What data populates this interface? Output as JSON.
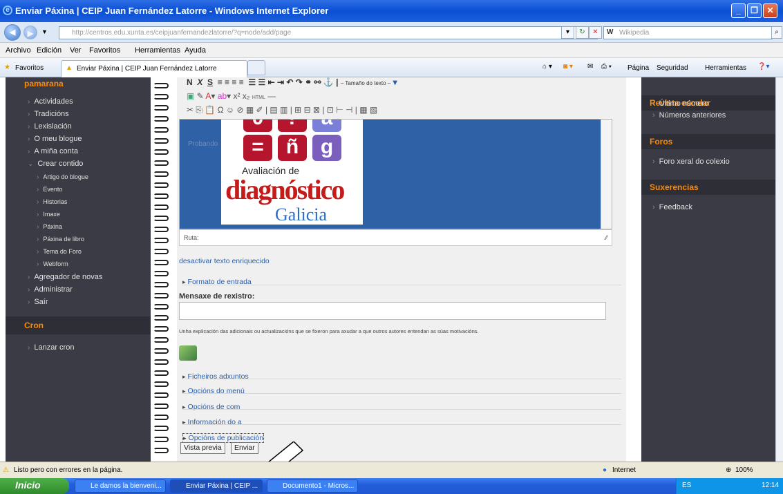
{
  "window": {
    "title": "Enviar Páxina | CEIP Juan Fernández Latorre - Windows Internet Explorer"
  },
  "address": {
    "url": "http://centros.edu.xunta.es/ceipjuanfernandezlatorre/?q=node/add/page",
    "url_host": "centros.edu.xunta.es",
    "search_placeholder": "Wikipedia"
  },
  "menu": [
    "Archivo",
    "Edición",
    "Ver",
    "Favoritos",
    "Herramientas",
    "Ayuda"
  ],
  "favbar": {
    "favorites_label": "Favoritos",
    "tab_label": "Enviar Páxina | CEIP Juan Fernández Latorre",
    "pagina": "Página",
    "seguridad": "Seguridad",
    "herramientas": "Herramientas"
  },
  "left": {
    "heading": "pamarana",
    "items": [
      "Actividades",
      "Tradicións",
      "Lexislación",
      "O meu blogue",
      "A miña conta",
      "Crear contido"
    ],
    "subitems": [
      "Artigo do blogue",
      "Evento",
      "Historias",
      "Imaxe",
      "Páxina",
      "Páxina de libro",
      "Tema do Foro",
      "Webform"
    ],
    "items2": [
      "Agregador de novas",
      "Administrar",
      "Saír"
    ],
    "cron_heading": "Cron",
    "cron_item": "Lanzar cron"
  },
  "right": {
    "h1": "Revista escolar",
    "h1_items": [
      "Último número",
      "Números anteriores"
    ],
    "h2": "Foros",
    "h2_items": [
      "Foro xeral do colexio"
    ],
    "h3": "Suxerencias",
    "h3_items": [
      "Feedback"
    ]
  },
  "editor": {
    "toolbar_size": "– Tamaño do texto –",
    "probando": "Probando",
    "logo_line1": "Avaliación de",
    "logo_line2": "diagnóstico",
    "logo_line3": "Galicia",
    "ruta": "Ruta:",
    "disable_rich": "desactivar texto enriquecido",
    "formato": "Formato de entrada",
    "msg_label": "Mensaxe de rexistro:",
    "msg_help": "Unha explicación das adicionais ou actualizacións que se fixeron para axudar a que outros autores entendan as súas motivacións.",
    "sections": [
      "Ficheiros adxuntos",
      "Opcións do menú",
      "Opcións de com",
      "Información do a",
      "Opcións de publicación"
    ],
    "btn_preview": "Vista previa",
    "btn_send": "Enviar"
  },
  "status": {
    "text": "Listo pero con errores en la página.",
    "zone": "Internet",
    "zoom": "100%"
  },
  "taskbar": {
    "start": "Inicio",
    "tasks": [
      "Le damos la bienveni...",
      "Enviar Páxina | CEIP ...",
      "Documento1 - Micros..."
    ],
    "lang": "ES",
    "clock": "12:14"
  }
}
